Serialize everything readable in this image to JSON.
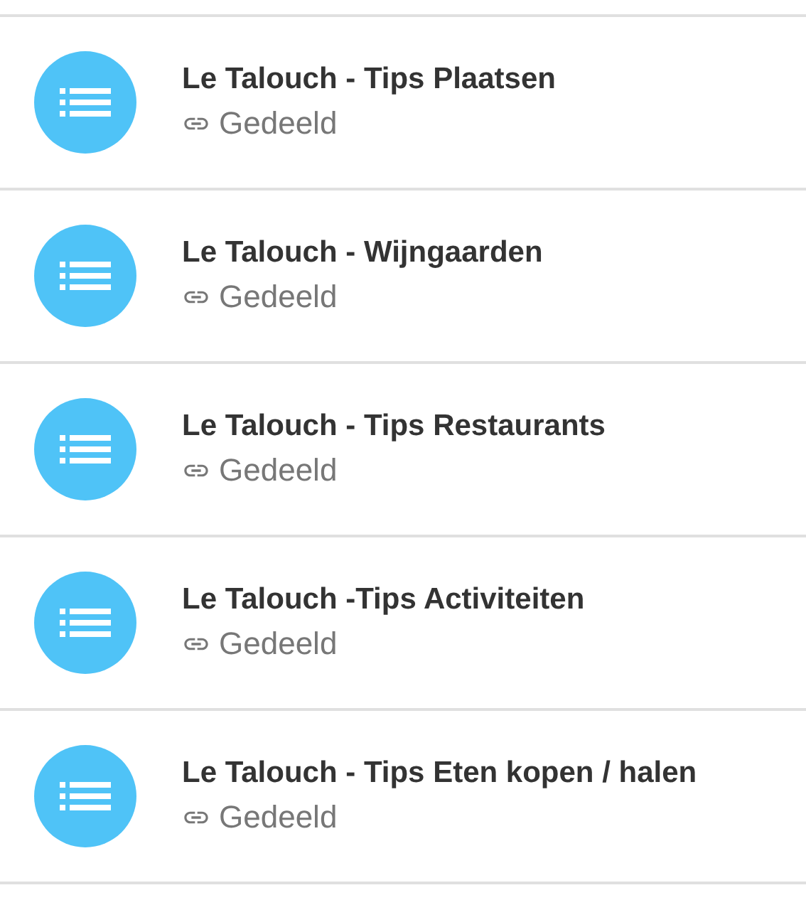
{
  "items": [
    {
      "title": "Le Talouch - Tips Plaatsen",
      "subtitle": "Gedeeld"
    },
    {
      "title": "Le Talouch - Wijngaarden",
      "subtitle": "Gedeeld"
    },
    {
      "title": "Le Talouch - Tips Restaurants",
      "subtitle": "Gedeeld"
    },
    {
      "title": "Le Talouch -Tips Activiteiten",
      "subtitle": "Gedeeld"
    },
    {
      "title": "Le Talouch - Tips Eten kopen / halen",
      "subtitle": "Gedeeld"
    }
  ]
}
